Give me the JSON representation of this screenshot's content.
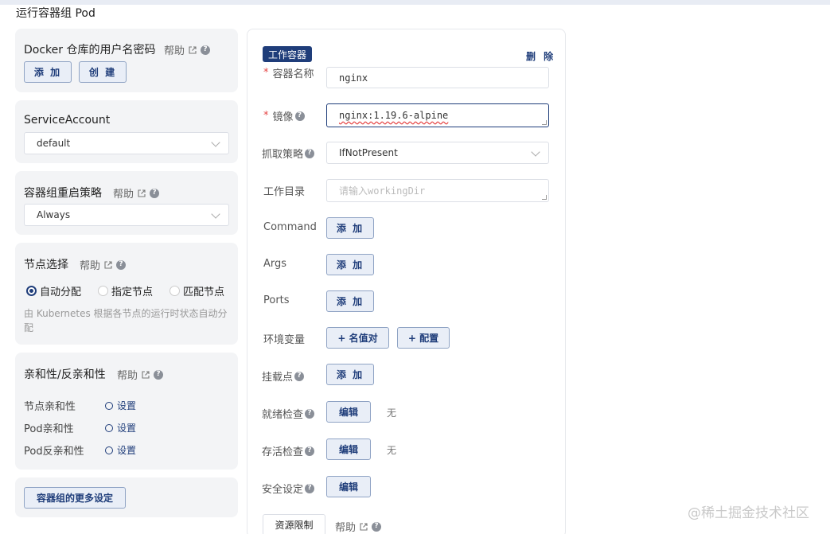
{
  "page": {
    "title": "运行容器组 Pod"
  },
  "left": {
    "docker": {
      "title": "Docker 仓库的用户名密码",
      "help": "帮助",
      "add": "添 加",
      "create": "创 建"
    },
    "service_account": {
      "title": "ServiceAccount",
      "value": "default"
    },
    "restart": {
      "title": "容器组重启策略",
      "help": "帮助",
      "value": "Always"
    },
    "node": {
      "title": "节点选择",
      "help": "帮助",
      "options": [
        "自动分配",
        "指定节点",
        "匹配节点"
      ],
      "selected": "自动分配",
      "desc": "由 Kubernetes 根据各节点的运行时状态自动分配"
    },
    "affinity": {
      "title": "亲和性/反亲和性",
      "help": "帮助",
      "rows": [
        {
          "label": "节点亲和性",
          "action": "设置"
        },
        {
          "label": "Pod亲和性",
          "action": "设置"
        },
        {
          "label": "Pod反亲和性",
          "action": "设置"
        }
      ]
    },
    "more": {
      "label": "容器组的更多设定"
    }
  },
  "container": {
    "tag": "工作容器",
    "delete": "删 除",
    "name": {
      "label": "容器名称",
      "value": "nginx"
    },
    "image": {
      "label": "镜像",
      "value": "nginx:1.19.6-alpine"
    },
    "pull_policy": {
      "label": "抓取策略",
      "value": "IfNotPresent"
    },
    "workdir": {
      "label": "工作目录",
      "placeholder": "请输入workingDir"
    },
    "command": {
      "label": "Command",
      "button": "添 加"
    },
    "args": {
      "label": "Args",
      "button": "添 加"
    },
    "ports": {
      "label": "Ports",
      "button": "添 加"
    },
    "env": {
      "label": "环境变量",
      "button1": "+ 名值对",
      "button2": "+ 配置"
    },
    "mounts": {
      "label": "挂载点",
      "button": "添 加"
    },
    "readiness": {
      "label": "就绪检查",
      "button": "编辑",
      "status": "无"
    },
    "liveness": {
      "label": "存活检查",
      "button": "编辑",
      "status": "无"
    },
    "security": {
      "label": "安全设定",
      "button": "编辑"
    },
    "resources": {
      "button": "资源限制",
      "help": "帮助"
    }
  },
  "watermark": "@稀土掘金技术社区",
  "colors": {
    "primary": "#1f3d7a",
    "required": "#e54545",
    "card_bg": "#f3f4f6"
  }
}
